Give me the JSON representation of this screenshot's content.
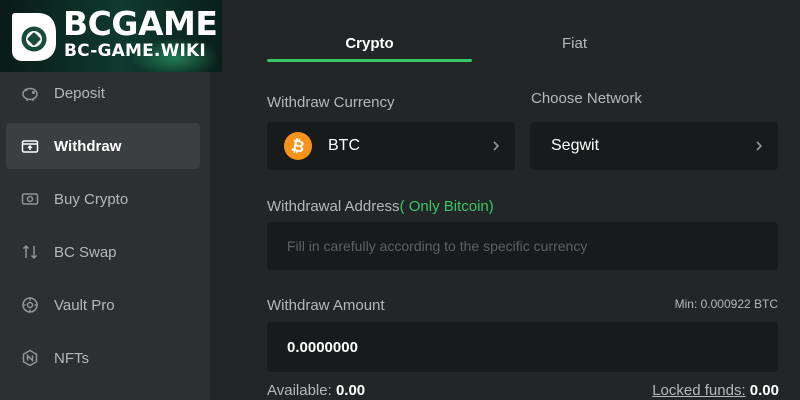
{
  "brand": {
    "title": "BCGAME",
    "subtitle": "BC-GAME.WIKI",
    "logo_icon": "bc-logo-icon"
  },
  "sidebar": {
    "items": [
      {
        "label": "Deposit",
        "icon": "piggy-bank-icon",
        "active": false
      },
      {
        "label": "Withdraw",
        "icon": "wallet-out-icon",
        "active": true
      },
      {
        "label": "Buy Crypto",
        "icon": "buy-crypto-icon",
        "active": false
      },
      {
        "label": "BC Swap",
        "icon": "swap-icon",
        "active": false
      },
      {
        "label": "Vault Pro",
        "icon": "vault-icon",
        "active": false
      },
      {
        "label": "NFTs",
        "icon": "nft-icon",
        "active": false
      }
    ]
  },
  "tabs": [
    {
      "label": "Crypto",
      "active": true
    },
    {
      "label": "Fiat",
      "active": false
    }
  ],
  "form": {
    "currency_label": "Withdraw Currency",
    "currency_value": "BTC",
    "network_label": "Choose Network",
    "network_value": "Segwit",
    "address_label": "Withdrawal Address",
    "address_hint": "( Only Bitcoin)",
    "address_placeholder": "Fill in carefully according to the specific currency",
    "amount_label": "Withdraw Amount",
    "amount_min": "Min: 0.000922 BTC",
    "amount_value": "0.0000000",
    "available_label": "Available:",
    "available_value": "0.00",
    "locked_label": "Locked funds:",
    "locked_value": "0.00"
  },
  "colors": {
    "accent": "#37c765",
    "background": "#232626",
    "sidebar": "#2c3030",
    "field": "#181b1b",
    "btc": "#f7931a"
  }
}
